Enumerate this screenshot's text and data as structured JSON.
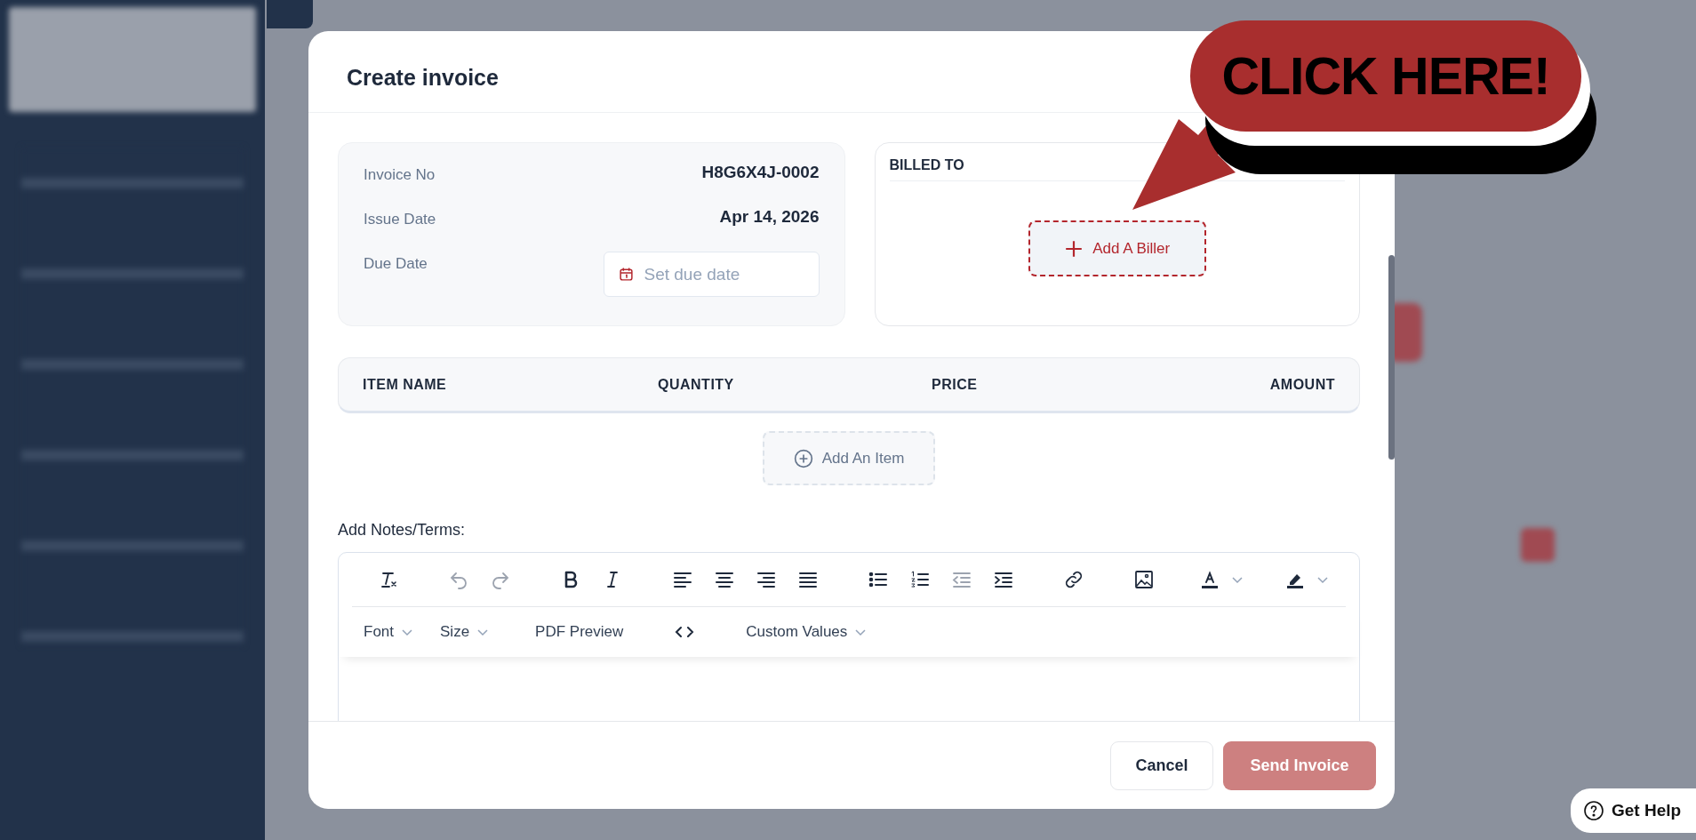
{
  "modal": {
    "title": "Create invoice",
    "details": [
      {
        "kind": "text",
        "label": "Invoice No",
        "value": "H8G6X4J-0002"
      },
      {
        "kind": "text",
        "label": "Issue Date",
        "value": "Apr 14, 2026"
      },
      {
        "kind": "date",
        "label": "Due Date",
        "placeholder": "Set due date"
      }
    ],
    "billed_to": {
      "heading": "BILLED TO",
      "button": "Add A Biller"
    },
    "items_table": {
      "columns": [
        "ITEM NAME",
        "QUANTITY",
        "PRICE",
        "AMOUNT"
      ],
      "add_button": "Add An Item"
    },
    "notes": {
      "label": "Add Notes/Terms:",
      "toolbar": [
        {
          "kind": "clear-format",
          "disabled": false
        },
        {
          "kind": "undo",
          "disabled": true
        },
        {
          "kind": "redo",
          "disabled": true
        },
        {
          "kind": "bold",
          "disabled": false
        },
        {
          "kind": "italic",
          "disabled": false
        },
        {
          "kind": "align-left",
          "disabled": false
        },
        {
          "kind": "align-center",
          "disabled": false
        },
        {
          "kind": "align-right",
          "disabled": false
        },
        {
          "kind": "justify",
          "disabled": false
        },
        {
          "kind": "bullet-list",
          "disabled": false
        },
        {
          "kind": "numbered-list",
          "disabled": false
        },
        {
          "kind": "outdent",
          "disabled": true
        },
        {
          "kind": "indent",
          "disabled": false
        },
        {
          "kind": "link",
          "disabled": false
        },
        {
          "kind": "image",
          "disabled": false
        },
        {
          "kind": "text-color",
          "disabled": false
        },
        {
          "kind": "highlight",
          "disabled": false
        }
      ],
      "menus": [
        {
          "kind": "dropdown",
          "label": "Font"
        },
        {
          "kind": "dropdown",
          "label": "Size"
        },
        {
          "kind": "button",
          "label": "PDF Preview"
        },
        {
          "kind": "code"
        },
        {
          "kind": "dropdown",
          "label": "Custom Values"
        }
      ]
    },
    "footer_buttons": [
      {
        "kind": "secondary",
        "label": "Cancel",
        "disabled": false
      },
      {
        "kind": "primary",
        "label": "Send Invoice",
        "disabled": true
      }
    ]
  },
  "callout": {
    "text": "CLICK HERE!"
  },
  "help_button": {
    "label": "Get Help"
  }
}
